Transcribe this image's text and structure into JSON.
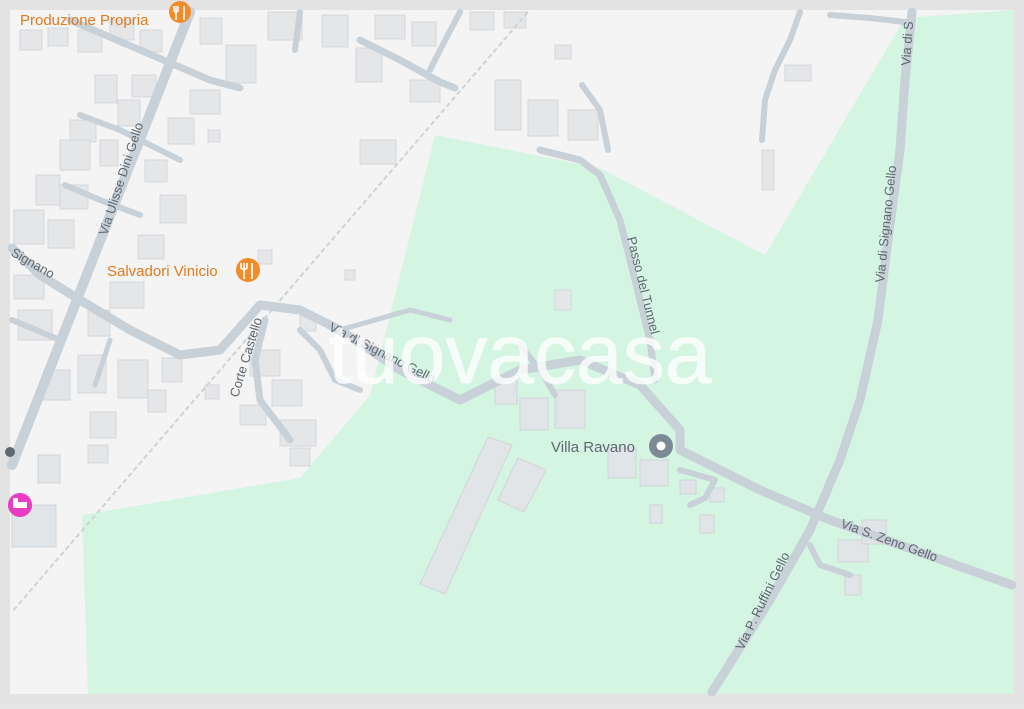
{
  "map": {
    "watermark": "tuovacasa",
    "colors": {
      "frame": "#e3e3e3",
      "land": "#f4f4f4",
      "park": "#d5f5e3",
      "road": "#c8d0d8",
      "road_edge": "#b6c0ca",
      "building": "#e4e6e8",
      "building_edge": "#d4d7da",
      "poi_orange": "#f08c2a",
      "poi_pink": "#e83cc3",
      "label_text": "#5f6770",
      "watermark": "#ffffff"
    },
    "roads": {
      "via_ulisse_dini_gello": "Via Ulisse Dini Gello",
      "via_di_signano_gello": "Via di Signano Gello",
      "via_di_signano_gello_east": "Via di Signano Gello",
      "via_di_signano_gello_top": "Via di S",
      "signano_left": "Signano",
      "corte_castello": "Corte Castello",
      "passo_del_tunnel": "Passo del Tunnel",
      "via_s_zeno_gello": "Via S. Zeno Gello",
      "via_p_ruffini_gello": "Via P. Ruffini Gello"
    },
    "pois": {
      "produzione_propria": {
        "label": "Produzione Propria",
        "icon": "restaurant-icon"
      },
      "salvadori_vinicio": {
        "label": "Salvadori Vinicio",
        "icon": "restaurant-icon"
      },
      "villa_ravano": {
        "label": "Villa Ravano",
        "icon": "location-pin-icon"
      },
      "hotel": {
        "label": "",
        "icon": "hotel-bed-icon"
      }
    }
  }
}
